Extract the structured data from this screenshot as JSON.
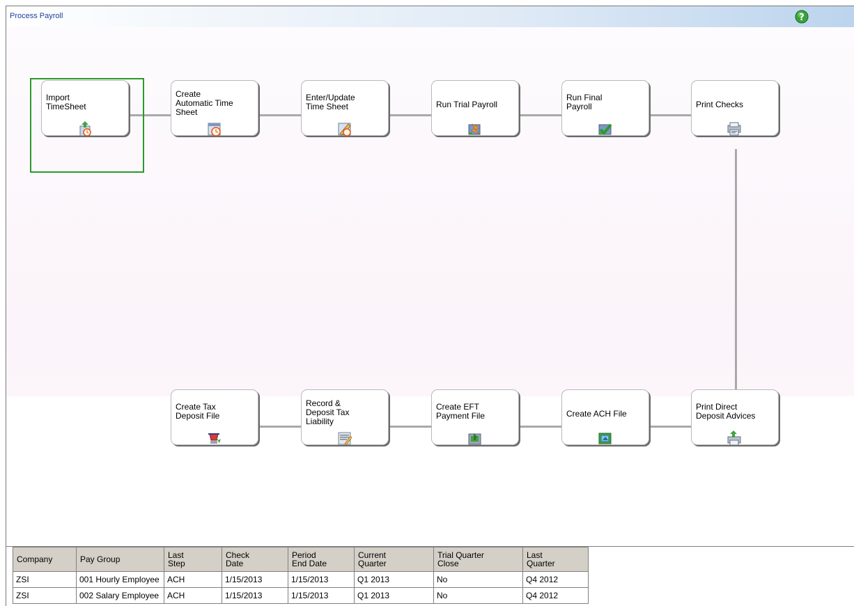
{
  "window": {
    "title": "Process Payroll"
  },
  "workflow": {
    "top_row": [
      {
        "label": "Import\nTimeSheet",
        "icon": "import-timesheet-icon",
        "selected": true
      },
      {
        "label": "Create\nAutomatic Time\nSheet",
        "icon": "auto-timesheet-icon"
      },
      {
        "label": "Enter/Update\nTime Sheet",
        "icon": "edit-timesheet-icon"
      },
      {
        "label": "Run Trial Payroll",
        "icon": "trial-payroll-icon"
      },
      {
        "label": "Run Final\nPayroll",
        "icon": "final-payroll-icon"
      },
      {
        "label": "Print Checks",
        "icon": "print-checks-icon"
      }
    ],
    "bottom_row": [
      {
        "label": "Create Tax\nDeposit File",
        "icon": "tax-deposit-icon"
      },
      {
        "label": "Record &\nDeposit Tax\nLiability",
        "icon": "tax-liability-icon"
      },
      {
        "label": "Create EFT\nPayment File",
        "icon": "eft-file-icon"
      },
      {
        "label": "Create ACH File",
        "icon": "ach-file-icon"
      },
      {
        "label": "Print Direct\nDeposit Advices",
        "icon": "deposit-advice-icon"
      }
    ]
  },
  "grid": {
    "columns": [
      "Company",
      "Pay Group",
      "Last\nStep",
      "Check\nDate",
      "Period\nEnd Date",
      "Current\nQuarter",
      "Trial Quarter\nClose",
      "Last\nQuarter"
    ],
    "rows": [
      [
        "ZSI",
        "001 Hourly Employee",
        "ACH",
        "1/15/2013",
        "1/15/2013",
        "Q1 2013",
        "No",
        "Q4 2012"
      ],
      [
        "ZSI",
        "002 Salary Employee",
        "ACH",
        "1/15/2013",
        "1/15/2013",
        "Q1 2013",
        "No",
        "Q4 2012"
      ]
    ]
  },
  "colors": {
    "selection": "#2a9a2a",
    "connector": "#a9a9a9",
    "title_text": "#1c3f9a"
  }
}
